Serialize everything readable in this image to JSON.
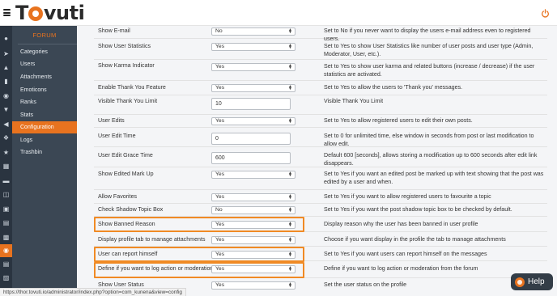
{
  "header": {
    "logo_text_prefix": "T",
    "logo_text_suffix": "vuti",
    "menu_icon": "hamburger-icon",
    "power_icon": "power-icon"
  },
  "rail": {
    "icons": [
      "chat-icon",
      "rocket-icon",
      "graduation-cap-icon",
      "bar-chart-icon",
      "users-icon",
      "trophy-icon",
      "megaphone-icon",
      "puzzle-icon",
      "star-icon",
      "table-icon",
      "credit-card-icon",
      "sitemap-icon",
      "user-square-icon",
      "cart-icon",
      "address-book-icon",
      "list-icon",
      "forum-icon",
      "document-icon",
      "contact-card-icon"
    ],
    "active_icon": "forum-icon"
  },
  "subnav": {
    "title": "FORUM",
    "items": [
      "Categories",
      "Users",
      "Attachments",
      "Emoticons",
      "Ranks",
      "Stats",
      "Configuration",
      "Logs",
      "Trashbin"
    ],
    "active": "Configuration"
  },
  "settings": [
    {
      "label": "Show E-mail",
      "type": "select",
      "value": "No",
      "description": "Set to No if you never want to display the users e-mail address even to registered users."
    },
    {
      "label": "Show User Statistics",
      "type": "select",
      "value": "Yes",
      "description": "Set to Yes to show User Statistics like number of user posts and user type (Admin, Moderator, User, etc.)."
    },
    {
      "label": "Show Karma Indicator",
      "type": "select",
      "value": "Yes",
      "description": "Set to Yes to show user karma and related buttons (increase / decrease) if the user statistics are activated."
    },
    {
      "label": "Enable Thank You Feature",
      "type": "select",
      "value": "Yes",
      "description": "Set to Yes to allow the users to 'Thank you' messages."
    },
    {
      "label": "Visible Thank You Limit",
      "type": "input",
      "value": "10",
      "description": "Visible Thank You Limit"
    },
    {
      "label": "User Edits",
      "type": "select",
      "value": "Yes",
      "description": "Set to Yes to allow registered users to edit their own posts."
    },
    {
      "label": "User Edit Time",
      "type": "input",
      "value": "0",
      "description": "Set to 0 for unlimited time, else window in seconds from post or last modification to allow edit."
    },
    {
      "label": "User Edit Grace Time",
      "type": "input",
      "value": "600",
      "description": "Default 600 [seconds], allows storing a modification up to 600 seconds after edit link disappears."
    },
    {
      "label": "Show Edited Mark Up",
      "type": "select",
      "value": "Yes",
      "description": "Set to Yes if you want an edited post be marked up with text showing that the post was edited by a user and when."
    },
    {
      "label": "Allow Favorites",
      "type": "select",
      "value": "Yes",
      "description": "Set to Yes if you want to allow registered users to favourite a topic"
    },
    {
      "label": "Check Shadow Topic Box",
      "type": "select",
      "value": "No",
      "description": "Set to Yes if you want the post shadow topic box to be checked by default."
    },
    {
      "label": "Show Banned Reason",
      "type": "select",
      "value": "Yes",
      "description": "Display reason why the user has been banned in user profile"
    },
    {
      "label": "Display profile tab to manage attachments",
      "type": "select",
      "value": "Yes",
      "description": "Choose if you want display in the profile the tab to manage attachments"
    },
    {
      "label": "User can report himself",
      "type": "select",
      "value": "Yes",
      "description": "Set to Yes if you want users can report himself on the messages"
    },
    {
      "label": "Define if you want to log action or moderation",
      "type": "select",
      "value": "Yes",
      "description": "Define if you want to log action or moderation from the forum"
    },
    {
      "label": "Show User Status",
      "type": "select",
      "value": "Yes",
      "description": "Set the user status on the profile"
    }
  ],
  "status_url": "https://thor.tovuti.io/administrator/index.php?option=com_kunena&view=config",
  "help": {
    "label": "Help",
    "icon": "tovuti-help-icon"
  },
  "colors": {
    "accent": "#e8731f",
    "highlight": "#f08a24",
    "sidebar_dark": "#2a3440",
    "sidebar": "#3b4754"
  }
}
